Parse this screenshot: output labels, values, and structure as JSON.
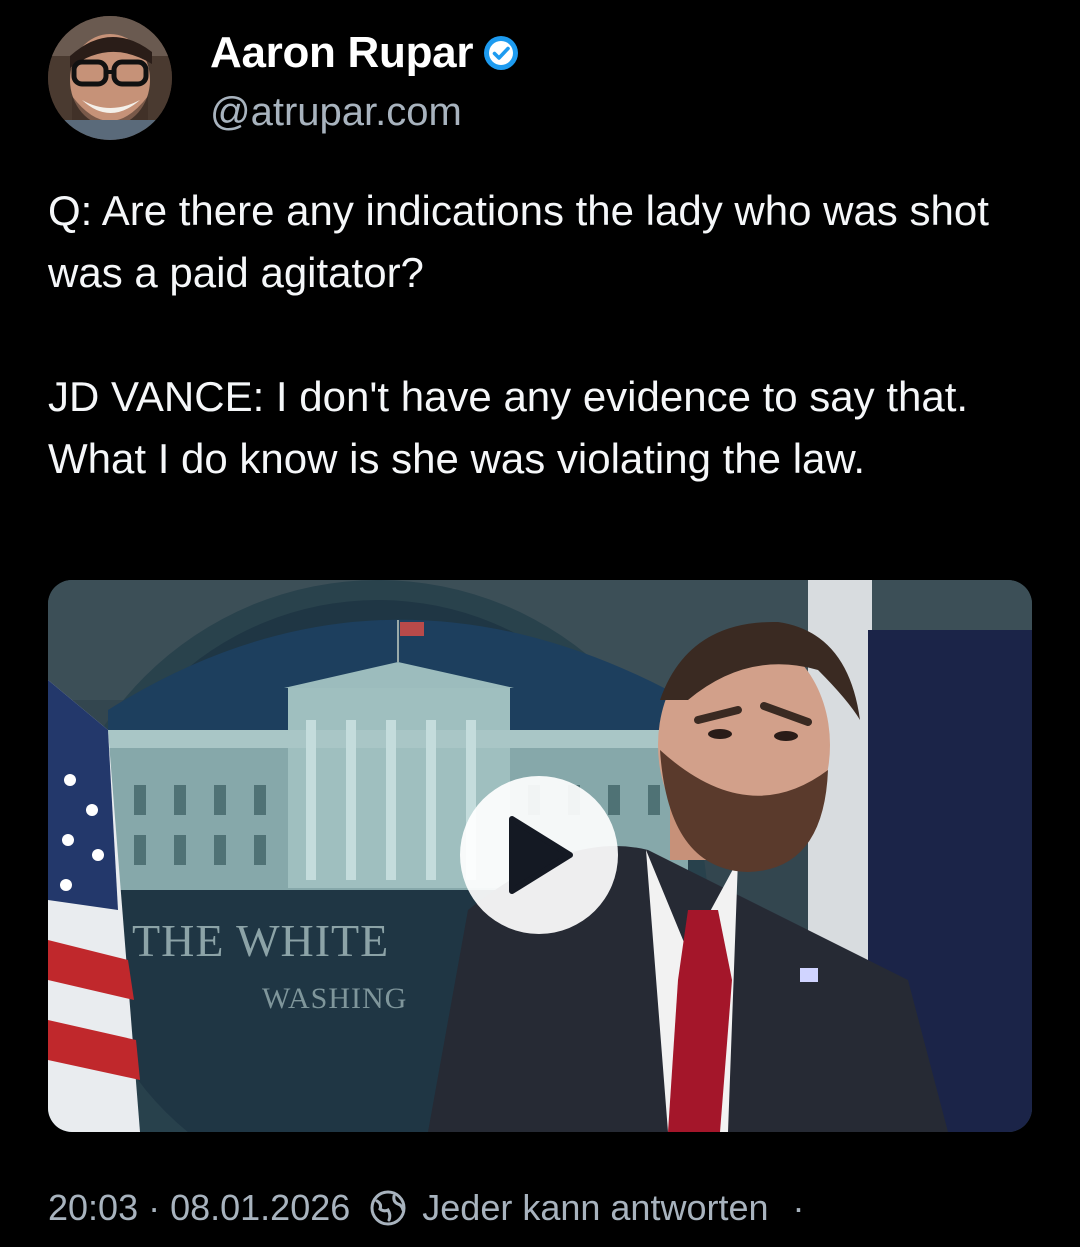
{
  "author": {
    "display_name": "Aaron Rupar",
    "handle": "@atrupar.com",
    "verified_icon": "verified-badge-icon",
    "avatar_icon": "avatar-photo"
  },
  "post": {
    "paragraphs": [
      "Q: Are there any indications the lady who was shot was a paid agitator?",
      "JD VANCE: I don't have any evidence to say that. What I do know is she was violating the law."
    ]
  },
  "media": {
    "type": "video",
    "play_icon": "play-icon",
    "seal_text_line1": "THE WHITE",
    "seal_text_line2": "WASHING"
  },
  "footer": {
    "time": "20:03",
    "separator": "·",
    "date": "08.01.2026",
    "reply_icon": "reply-settings-icon",
    "reply_setting": "Jeder kann antworten",
    "trailing_separator": "·"
  },
  "colors": {
    "background": "#000000",
    "text": "#f5f7f9",
    "muted": "#a8b3be",
    "verified": "#1d9bf0"
  }
}
